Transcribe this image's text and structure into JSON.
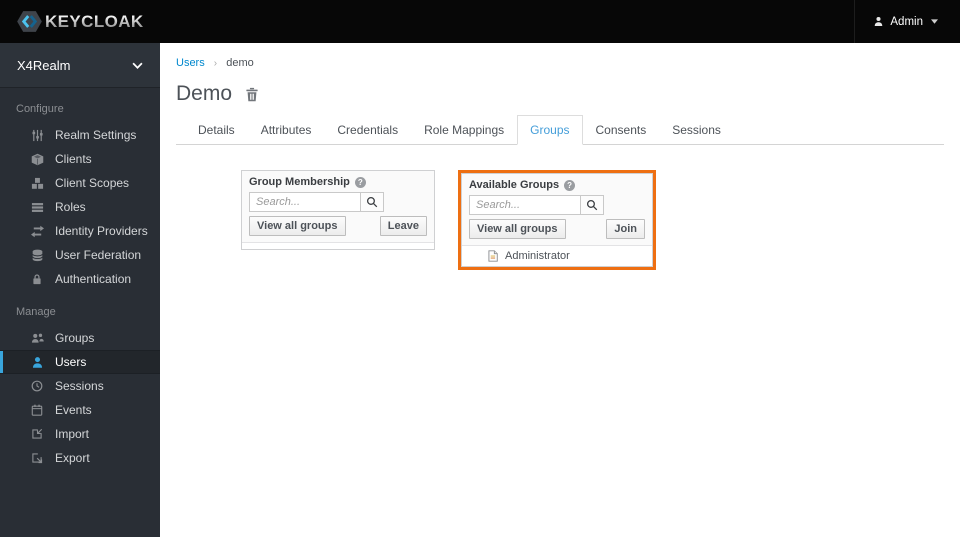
{
  "navbar": {
    "brand": "KEYCLOAK",
    "user": {
      "label": "Admin"
    }
  },
  "sidebar": {
    "realm": {
      "label": "X4Realm"
    },
    "sections": [
      {
        "label": "Configure",
        "items": [
          {
            "icon": "sliders-icon",
            "label": "Realm Settings"
          },
          {
            "icon": "cube-icon",
            "label": "Clients"
          },
          {
            "icon": "cubes-icon",
            "label": "Client Scopes"
          },
          {
            "icon": "list-icon",
            "label": "Roles"
          },
          {
            "icon": "exchange-icon",
            "label": "Identity Providers"
          },
          {
            "icon": "database-icon",
            "label": "User Federation"
          },
          {
            "icon": "lock-icon",
            "label": "Authentication"
          }
        ]
      },
      {
        "label": "Manage",
        "items": [
          {
            "icon": "users-group-icon",
            "label": "Groups"
          },
          {
            "icon": "user-icon",
            "label": "Users",
            "active": true
          },
          {
            "icon": "clock-icon",
            "label": "Sessions"
          },
          {
            "icon": "calendar-icon",
            "label": "Events"
          },
          {
            "icon": "import-icon",
            "label": "Import"
          },
          {
            "icon": "export-icon",
            "label": "Export"
          }
        ]
      }
    ]
  },
  "breadcrumb": {
    "items": [
      {
        "label": "Users"
      },
      {
        "label": "demo"
      }
    ],
    "separator": "›"
  },
  "page": {
    "title": "Demo"
  },
  "tabs": [
    {
      "label": "Details"
    },
    {
      "label": "Attributes"
    },
    {
      "label": "Credentials"
    },
    {
      "label": "Role Mappings"
    },
    {
      "label": "Groups",
      "active": true
    },
    {
      "label": "Consents"
    },
    {
      "label": "Sessions"
    }
  ],
  "panels": {
    "group_membership": {
      "title": "Group Membership",
      "search_placeholder": "Search...",
      "view_all_label": "View all groups",
      "action_label": "Leave"
    },
    "available_groups": {
      "title": "Available Groups",
      "search_placeholder": "Search...",
      "view_all_label": "View all groups",
      "action_label": "Join",
      "items": [
        {
          "icon": "file-icon",
          "label": "Administrator"
        }
      ]
    }
  },
  "colors": {
    "navbar_bg": "#070707",
    "sidebar_bg": "#292e35",
    "accent_blue": "#39a5dc",
    "link_blue": "#0088ce",
    "active_tab_blue": "#459ed9",
    "highlight_orange": "#ee6f12"
  }
}
